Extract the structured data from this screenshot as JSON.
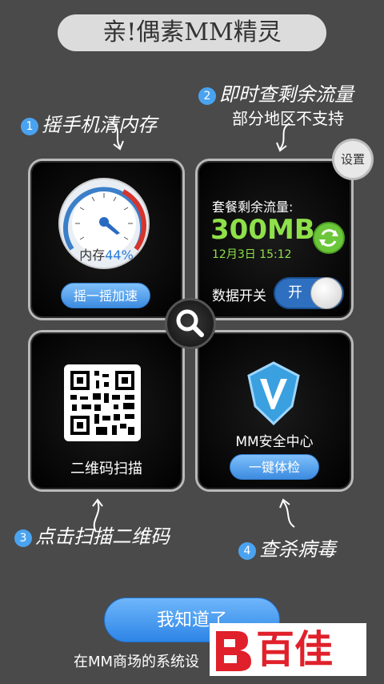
{
  "title": "亲!偶素MM精灵",
  "hints": {
    "h1": {
      "num": "1",
      "text": "摇手机清内存"
    },
    "h2": {
      "num": "2",
      "text": "即时查剩余流量",
      "sub": "部分地区不支持"
    },
    "h3": {
      "num": "3",
      "text": "点击扫描二维码"
    },
    "h4": {
      "num": "4",
      "text": "查杀病毒"
    }
  },
  "settings_label": "设置",
  "memory": {
    "label": "内存",
    "percent": "44%",
    "percent_value": 44,
    "button": "摇一摇加速"
  },
  "traffic": {
    "label": "套餐剩余流量:",
    "value": "300MB",
    "time": "12月3日 15:12",
    "switch_label": "数据开关",
    "switch_state": "开"
  },
  "qr": {
    "label": "二维码扫描"
  },
  "security": {
    "label": "MM安全中心",
    "button": "一键体检"
  },
  "ok_button": "我知道了",
  "footer": "在MM商场的系统设",
  "watermark": "百佳",
  "colors": {
    "accent_blue": "#3c8be0",
    "traffic_green": "#8fe04a",
    "number_badge": "#4aa3f0",
    "watermark_red": "#e0202a"
  }
}
